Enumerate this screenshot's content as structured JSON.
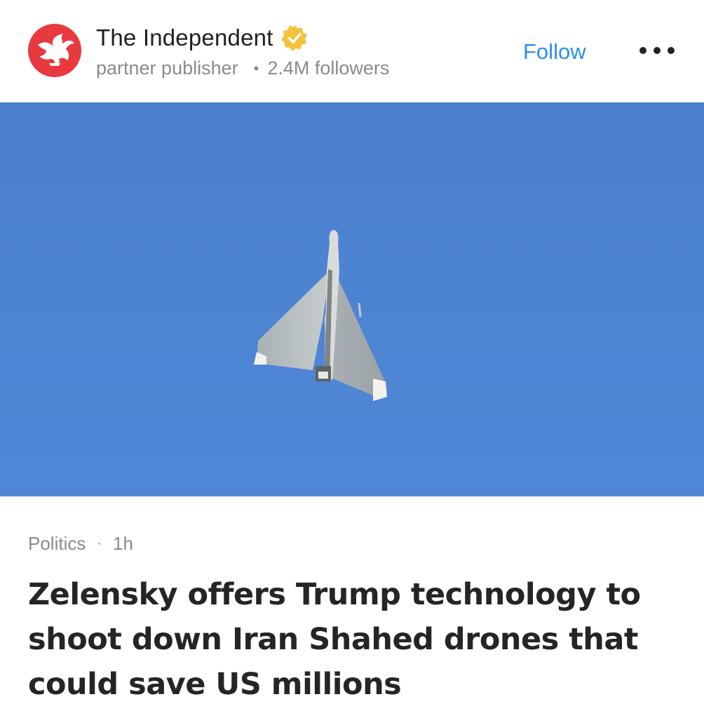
{
  "publisher": {
    "name": "The Independent",
    "type": "partner publisher",
    "followers": "2.4M followers",
    "follow_label": "Follow",
    "logo_icon": "eagle-logo-icon",
    "verified_icon": "verified-badge-icon",
    "brand_color": "#e8393f"
  },
  "article": {
    "category": "Politics",
    "separator": "·",
    "time": "1h",
    "headline": "Zelensky offers Trump technology to shoot down Iran Shahed drones that could save US millions",
    "image_icon": "drone-in-sky-image"
  },
  "colors": {
    "accent": "#2d8fe4",
    "sky": "#4d84d2",
    "verified": "#f3c33c"
  }
}
